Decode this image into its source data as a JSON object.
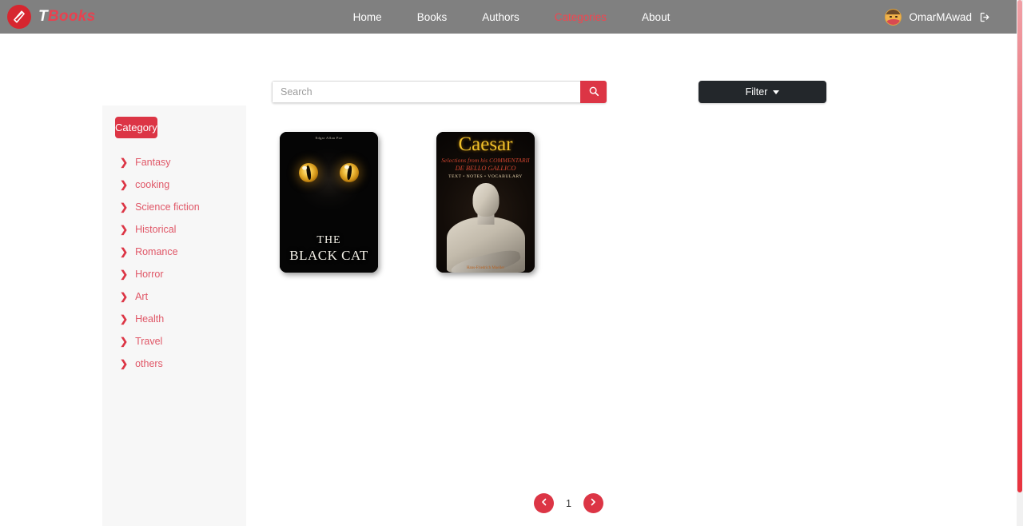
{
  "brand": {
    "letter": "T",
    "name": "Books",
    "logo_icon": "book-logo-icon"
  },
  "nav": {
    "links": [
      {
        "label": "Home",
        "active": false
      },
      {
        "label": "Books",
        "active": false
      },
      {
        "label": "Authors",
        "active": false
      },
      {
        "label": "Categories",
        "active": true
      },
      {
        "label": "About",
        "active": false
      }
    ]
  },
  "user": {
    "name": "OmarMAwad",
    "avatar_icon": "avatar",
    "logout_icon": "logout-icon"
  },
  "search": {
    "value": "",
    "placeholder": "Search",
    "button_icon": "search-icon"
  },
  "filter": {
    "label": "Filter",
    "caret_icon": "chevron-down-icon"
  },
  "sidebar": {
    "title": "Category",
    "items": [
      {
        "label": "Fantasy"
      },
      {
        "label": "cooking"
      },
      {
        "label": "Science fiction"
      },
      {
        "label": "Historical"
      },
      {
        "label": "Romance"
      },
      {
        "label": "Horror"
      },
      {
        "label": "Art"
      },
      {
        "label": "Health"
      },
      {
        "label": "Travel"
      },
      {
        "label": "others"
      }
    ]
  },
  "books": [
    {
      "id": "black-cat",
      "author_credit": "Edgar Allan Poe",
      "title_line1": "THE",
      "title_line2": "BLACK CAT"
    },
    {
      "id": "caesar",
      "title": "Caesar",
      "subtitle1": "Selections from his COMMENTARII",
      "subtitle2": "DE BELLO GALLICO",
      "subtitle3": "TEXT • NOTES • VOCABULARY",
      "credit": "Hans-Friedrich Mueller"
    }
  ],
  "pagination": {
    "prev_icon": "chevron-left-icon",
    "next_icon": "chevron-right-icon",
    "current_page": "1"
  },
  "colors": {
    "accent_red": "#dc3545",
    "brand_red": "#e8414f",
    "navbar_gray": "#808080",
    "dark_button": "#23272b",
    "sidebar_bg": "#f7f7f7"
  }
}
